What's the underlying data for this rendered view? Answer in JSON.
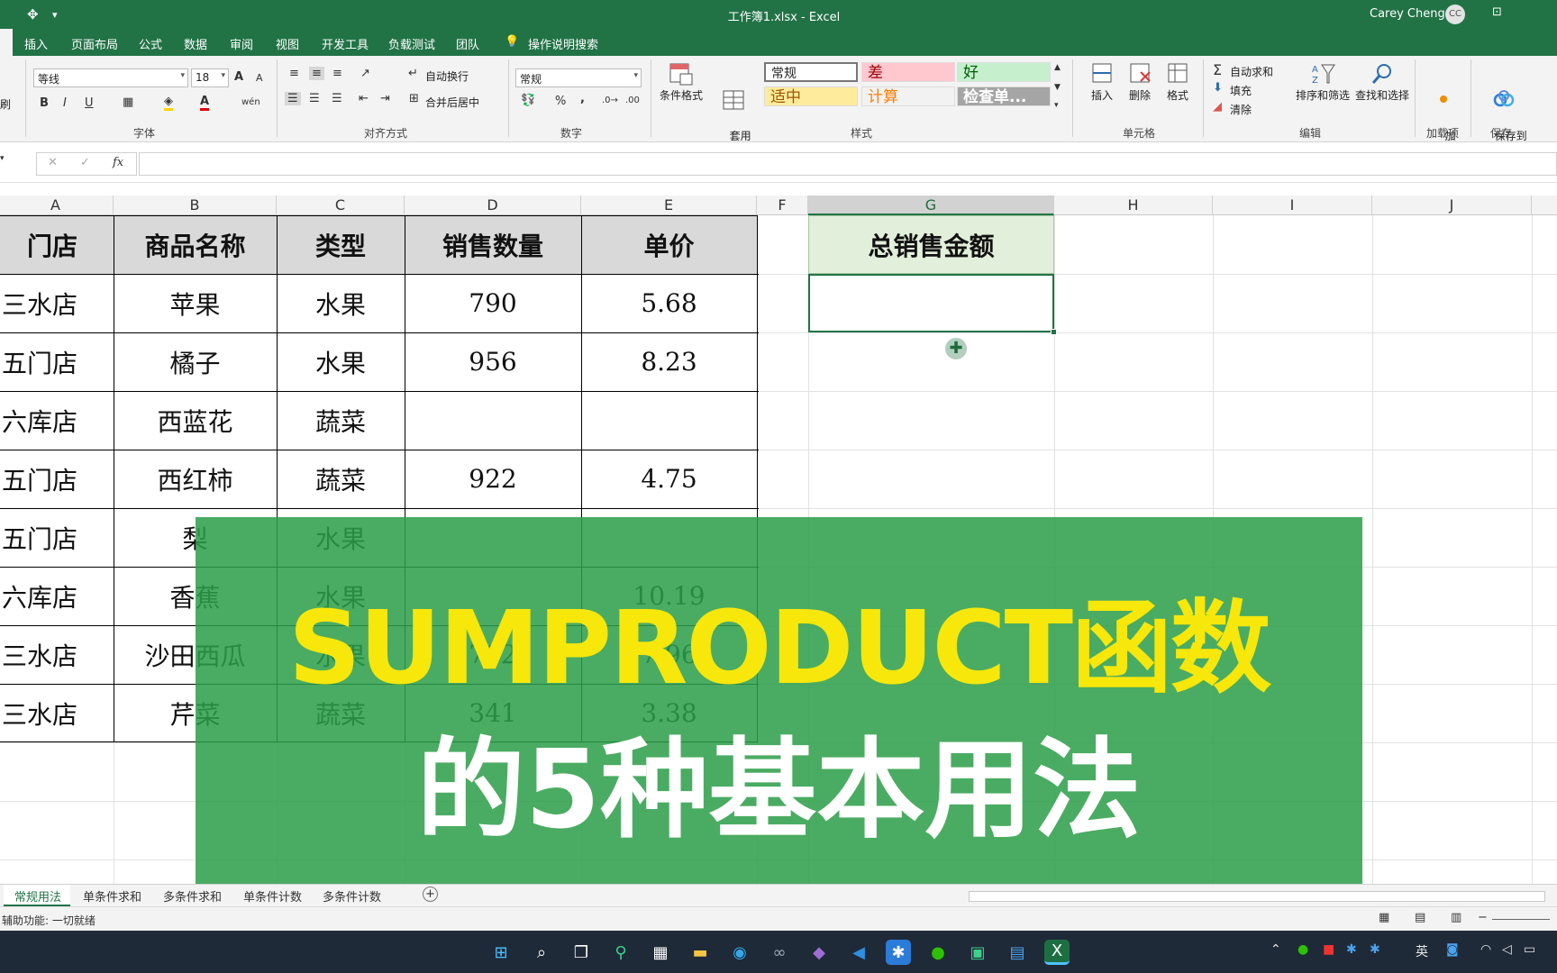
{
  "window": {
    "title": "工作簿1.xlsx  -  Excel",
    "user": "Carey Cheng",
    "avatar": "CC",
    "ribbon_options_icon": "ribbon-display-icon"
  },
  "quick_access": {
    "icon": "touch-mode-icon",
    "more": "▾"
  },
  "tabs": [
    "插入",
    "页面布局",
    "公式",
    "数据",
    "审阅",
    "视图",
    "开发工具",
    "负载测试",
    "团队",
    "操作说明搜索"
  ],
  "ribbon": {
    "font": {
      "name": "等线",
      "size": "18",
      "grow": "A",
      "shrink": "A",
      "bold": "B",
      "italic": "I",
      "underline": "U",
      "font_color_letter": "A",
      "phonetic": "wén",
      "group": "字体"
    },
    "clipboard": {
      "partial_label": "刷"
    },
    "align": {
      "wrap": "自动换行",
      "merge": "合并后居中",
      "group": "对齐方式"
    },
    "number": {
      "format": "常规",
      "percent": "%",
      "comma": ",",
      "group": "数字"
    },
    "styles": {
      "cond_format": "条件格式",
      "table_format": "套用\n表格格式",
      "cells": [
        {
          "label": "常规",
          "bg": "#ffffff",
          "color": "#222222"
        },
        {
          "label": "差",
          "bg": "#ffc7ce",
          "color": "#9c0006"
        },
        {
          "label": "好",
          "bg": "#c6efce",
          "color": "#006100"
        },
        {
          "label": "适中",
          "bg": "#ffeb9c",
          "color": "#9c5700"
        },
        {
          "label": "计算",
          "bg": "#f2f2f2",
          "color": "#fa7d00"
        },
        {
          "label": "检查单...",
          "bg": "#a5a5a5",
          "color": "#ffffff"
        }
      ],
      "group": "样式"
    },
    "cells_grp": {
      "insert": "插入",
      "delete": "删除",
      "format": "格式",
      "group": "单元格"
    },
    "editing": {
      "autosum": "自动求和",
      "fill": "填充",
      "clear": "清除",
      "sort": "排序和筛选",
      "find": "查找和选择",
      "group": "编辑"
    },
    "addins": {
      "label": "加\n载项",
      "group": "加载项"
    },
    "save": {
      "label": "保存到\n百度网盘",
      "group": "保存"
    }
  },
  "formula_bar": {
    "cancel": "✕",
    "enter": "✓",
    "fx": "fx",
    "value": ""
  },
  "columns": [
    "A",
    "B",
    "C",
    "D",
    "E",
    "F",
    "G",
    "H",
    "I",
    "J"
  ],
  "table": {
    "headers": [
      "门店",
      "商品名称",
      "类型",
      "销售数量",
      "单价"
    ],
    "rows": [
      [
        "三水店",
        "苹果",
        "水果",
        "790",
        "5.68"
      ],
      [
        "五门店",
        "橘子",
        "水果",
        "956",
        "8.23"
      ],
      [
        "六库店",
        "西蓝花",
        "蔬菜",
        "",
        ""
      ],
      [
        "五门店",
        "西红柿",
        "蔬菜",
        "922",
        "4.75"
      ],
      [
        "五门店",
        "梨",
        "水果",
        "",
        ""
      ],
      [
        "六库店",
        "香蕉",
        "水果",
        "",
        "10.19"
      ],
      [
        "三水店",
        "沙田西瓜",
        "水果",
        "702",
        "7.96"
      ],
      [
        "三水店",
        "芹菜",
        "蔬菜",
        "341",
        "3.38"
      ]
    ]
  },
  "total_header": "总销售金额",
  "overlay": {
    "line1": "SUMPRODUCT函数",
    "line2": "的5种基本用法"
  },
  "sheet_tabs": [
    "常规用法",
    "单条件求和",
    "多条件求和",
    "单条件计数",
    "多条件计数"
  ],
  "add_sheet": "+",
  "status": "辅助功能: 一切就绪",
  "taskbar": {
    "ime": "英"
  }
}
